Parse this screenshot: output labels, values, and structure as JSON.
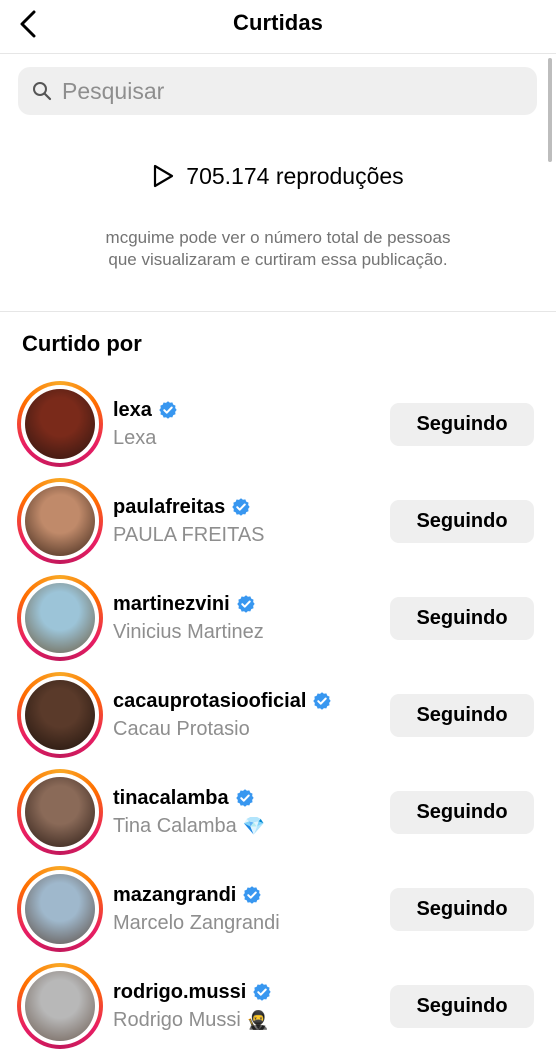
{
  "header": {
    "title": "Curtidas"
  },
  "search": {
    "placeholder": "Pesquisar"
  },
  "plays": {
    "text": "705.174 reproduções"
  },
  "info": {
    "line1": "mcguime pode ver o número total de pessoas",
    "line2": "que visualizaram e curtiram essa publicação."
  },
  "section": {
    "title": "Curtido por"
  },
  "users": [
    {
      "username": "lexa",
      "fullname": "Lexa",
      "emoji": "",
      "button": "Seguindo",
      "avatar_colors": [
        "#7a2a1a",
        "#2b1410"
      ]
    },
    {
      "username": "paulafreitas",
      "fullname": "PAULA FREITAS",
      "emoji": "",
      "button": "Seguindo",
      "avatar_colors": [
        "#c08a6a",
        "#3a2418"
      ]
    },
    {
      "username": "martinezvini",
      "fullname": "Vinicius Martinez",
      "emoji": "",
      "button": "Seguindo",
      "avatar_colors": [
        "#9cc4d8",
        "#6b5a3e"
      ]
    },
    {
      "username": "cacauprotasiooficial",
      "fullname": "Cacau Protasio",
      "emoji": "",
      "button": "Seguindo",
      "avatar_colors": [
        "#5a3a2a",
        "#1e120c"
      ]
    },
    {
      "username": "tinacalamba",
      "fullname": "Tina Calamba",
      "emoji": "💎",
      "button": "Seguindo",
      "avatar_colors": [
        "#8a6a58",
        "#2a1a14"
      ]
    },
    {
      "username": "mazangrandi",
      "fullname": "Marcelo Zangrandi",
      "emoji": "",
      "button": "Seguindo",
      "avatar_colors": [
        "#9fb8cc",
        "#5a4a40"
      ]
    },
    {
      "username": "rodrigo.mussi",
      "fullname": "Rodrigo Mussi",
      "emoji": "🥷",
      "button": "Seguindo",
      "avatar_colors": [
        "#b8b8b8",
        "#6a5a50"
      ]
    }
  ],
  "colors": {
    "verified": "#3897f0",
    "button_bg": "#efefef",
    "secondary_text": "#8e8e8e"
  },
  "icons": {
    "back": "chevron-left-icon",
    "search": "search-icon",
    "plays": "play-icon",
    "verified": "verified-badge-icon"
  }
}
